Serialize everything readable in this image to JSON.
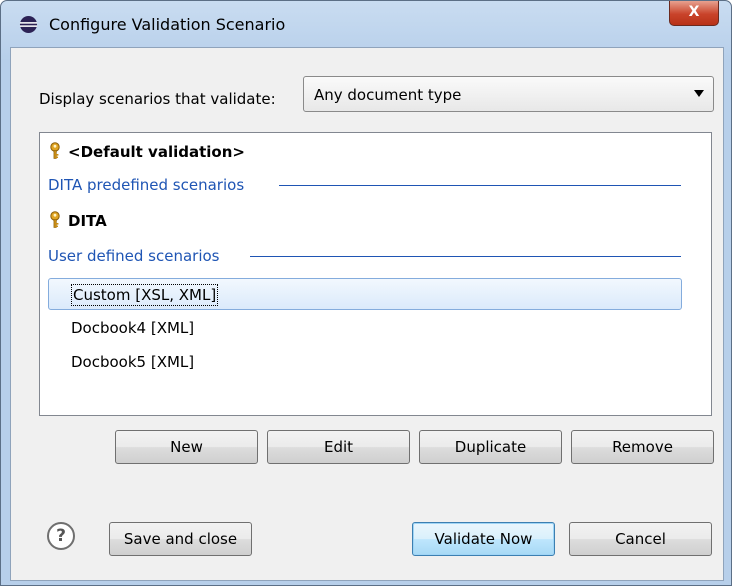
{
  "window": {
    "title": "Configure Validation Scenario",
    "close_label": "X",
    "colors": {
      "title_bg": "#c9dcf1",
      "close_bg": "#c9432a",
      "group_header": "#1f55b4",
      "selection_border": "#84acdd"
    }
  },
  "filter": {
    "label": "Display scenarios that validate:",
    "selected": "Any document type"
  },
  "scenarios": {
    "default_item": "<Default validation>",
    "group_predefined": "DITA predefined scenarios",
    "predefined": [
      {
        "label": "DITA",
        "icon": "key-icon"
      }
    ],
    "group_user": "User defined scenarios",
    "user": [
      {
        "label": "Custom [XSL, XML]",
        "selected": true
      },
      {
        "label": "Docbook4 [XML]",
        "selected": false
      },
      {
        "label": "Docbook5 [XML]",
        "selected": false
      }
    ]
  },
  "actions": {
    "new": "New",
    "edit": "Edit",
    "duplicate": "Duplicate",
    "remove": "Remove"
  },
  "footer": {
    "help_icon": "help-icon",
    "help_glyph": "?",
    "save_close": "Save and close",
    "validate_now": "Validate Now",
    "cancel": "Cancel"
  }
}
